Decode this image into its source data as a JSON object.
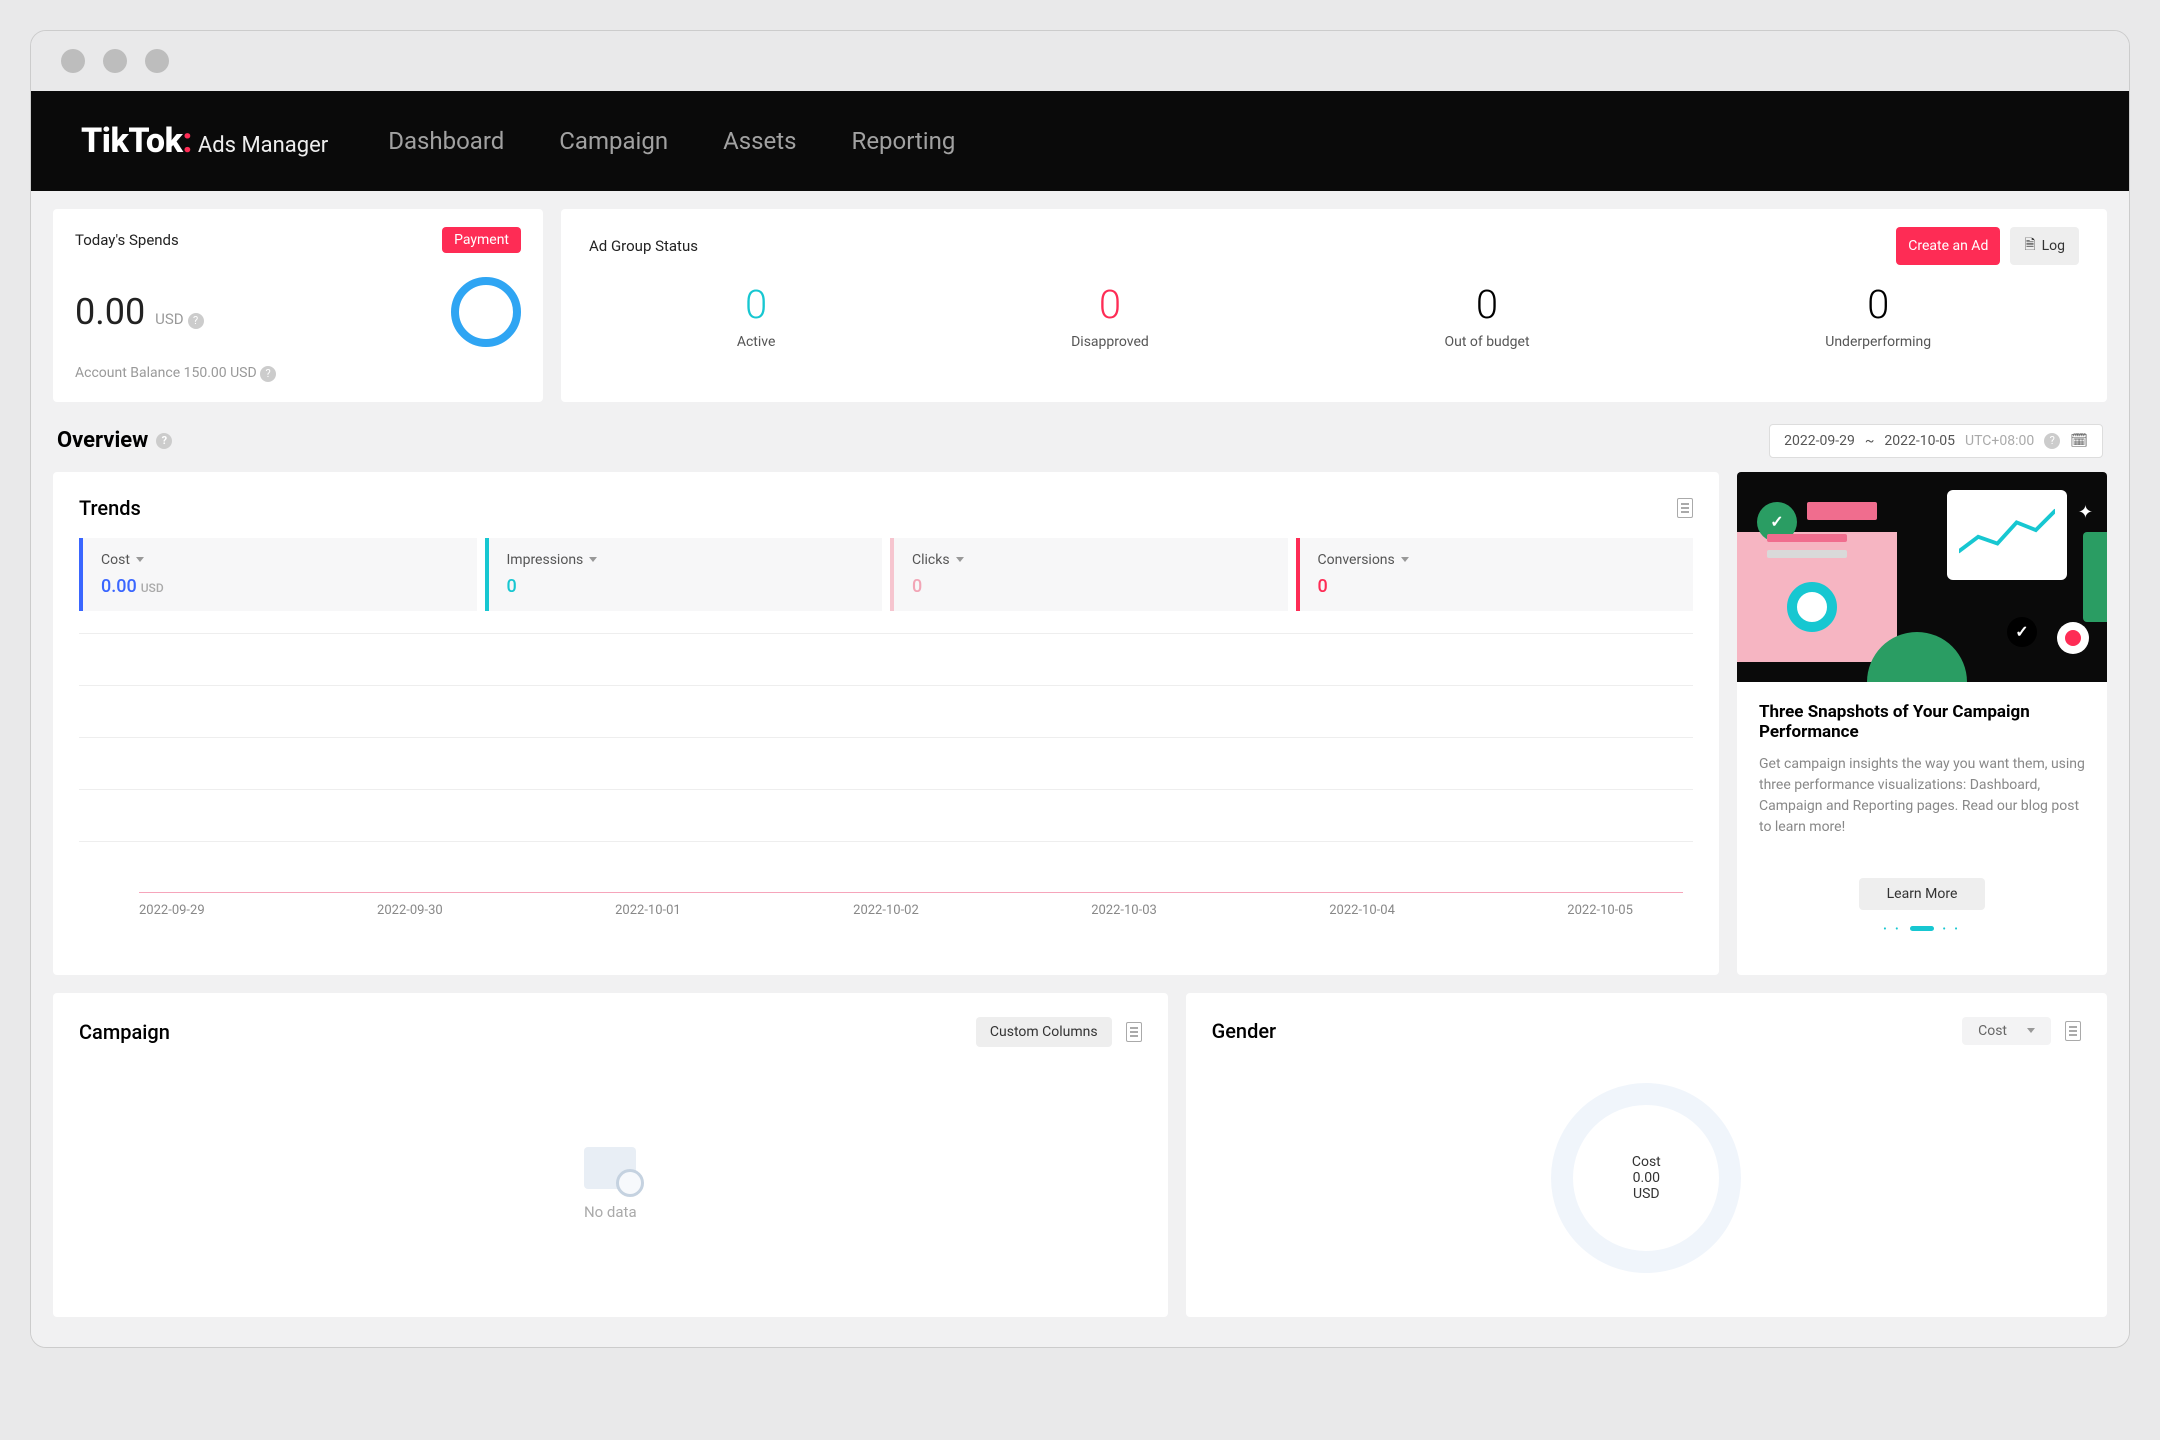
{
  "brand": {
    "name": "TikTok",
    "sub": "Ads Manager"
  },
  "nav": [
    "Dashboard",
    "Campaign",
    "Assets",
    "Reporting"
  ],
  "spend": {
    "title": "Today's Spends",
    "payment_btn": "Payment",
    "amount": "0.00",
    "currency": "USD",
    "balance_label": "Account Balance 150.00 USD"
  },
  "status": {
    "title": "Ad Group Status",
    "create_btn": "Create an Ad",
    "log_btn": "Log",
    "metrics": [
      {
        "value": "0",
        "label": "Active",
        "color": "cyan"
      },
      {
        "value": "0",
        "label": "Disapproved",
        "color": "red"
      },
      {
        "value": "0",
        "label": "Out of budget",
        "color": ""
      },
      {
        "value": "0",
        "label": "Underperforming",
        "color": ""
      }
    ]
  },
  "overview": {
    "title": "Overview",
    "date_from": "2022-09-29",
    "date_to": "2022-10-05",
    "tz": "UTC+08:00"
  },
  "trends": {
    "title": "Trends",
    "tiles": [
      {
        "label": "Cost",
        "value": "0.00",
        "suffix": "USD"
      },
      {
        "label": "Impressions",
        "value": "0",
        "suffix": ""
      },
      {
        "label": "Clicks",
        "value": "0",
        "suffix": ""
      },
      {
        "label": "Conversions",
        "value": "0",
        "suffix": ""
      }
    ]
  },
  "chart_data": {
    "type": "line",
    "x": [
      "2022-09-29",
      "2022-09-30",
      "2022-10-01",
      "2022-10-02",
      "2022-10-03",
      "2022-10-04",
      "2022-10-05"
    ],
    "series": [
      {
        "name": "Cost",
        "values": [
          0,
          0,
          0,
          0,
          0,
          0,
          0
        ]
      },
      {
        "name": "Impressions",
        "values": [
          0,
          0,
          0,
          0,
          0,
          0,
          0
        ]
      },
      {
        "name": "Clicks",
        "values": [
          0,
          0,
          0,
          0,
          0,
          0,
          0
        ]
      },
      {
        "name": "Conversions",
        "values": [
          0,
          0,
          0,
          0,
          0,
          0,
          0
        ]
      }
    ],
    "ylim": [
      0,
      1
    ],
    "xlabel": "",
    "ylabel": "",
    "title": ""
  },
  "promo": {
    "title": "Three Snapshots of Your Campaign Performance",
    "text": "Get campaign insights the way you want them, using three performance visualizations: Dashboard, Campaign and Reporting pages. Read our blog post to learn more!",
    "btn": "Learn More"
  },
  "campaign": {
    "title": "Campaign",
    "custom_btn": "Custom Columns",
    "nodata": "No data"
  },
  "gender": {
    "title": "Gender",
    "dropdown": "Cost",
    "center_label": "Cost",
    "center_value": "0.00",
    "center_currency": "USD"
  }
}
